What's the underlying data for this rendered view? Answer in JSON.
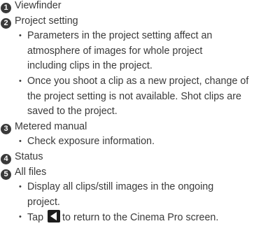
{
  "items": [
    {
      "number": "1",
      "title": "Viewfinder"
    },
    {
      "number": "2",
      "title": "Project setting",
      "bullets": [
        [
          "Parameters in the project setting affect an",
          "atmosphere of images for whole project",
          "including clips in the project."
        ],
        [
          "Once you shoot a clip as a new project, change of",
          "the project setting is not available. Shot clips are",
          "saved to the project."
        ]
      ]
    },
    {
      "number": "3",
      "title": "Metered manual",
      "bullets": [
        [
          "Check exposure information."
        ]
      ]
    },
    {
      "number": "4",
      "title": "Status"
    },
    {
      "number": "5",
      "title": "All files",
      "bullets": [
        [
          "Display all clips/still images in the ongoing",
          "project."
        ]
      ],
      "tap_note": {
        "before": "Tap",
        "icon": "back-arrow-icon",
        "after": "to return to the Cinema Pro screen."
      }
    }
  ]
}
